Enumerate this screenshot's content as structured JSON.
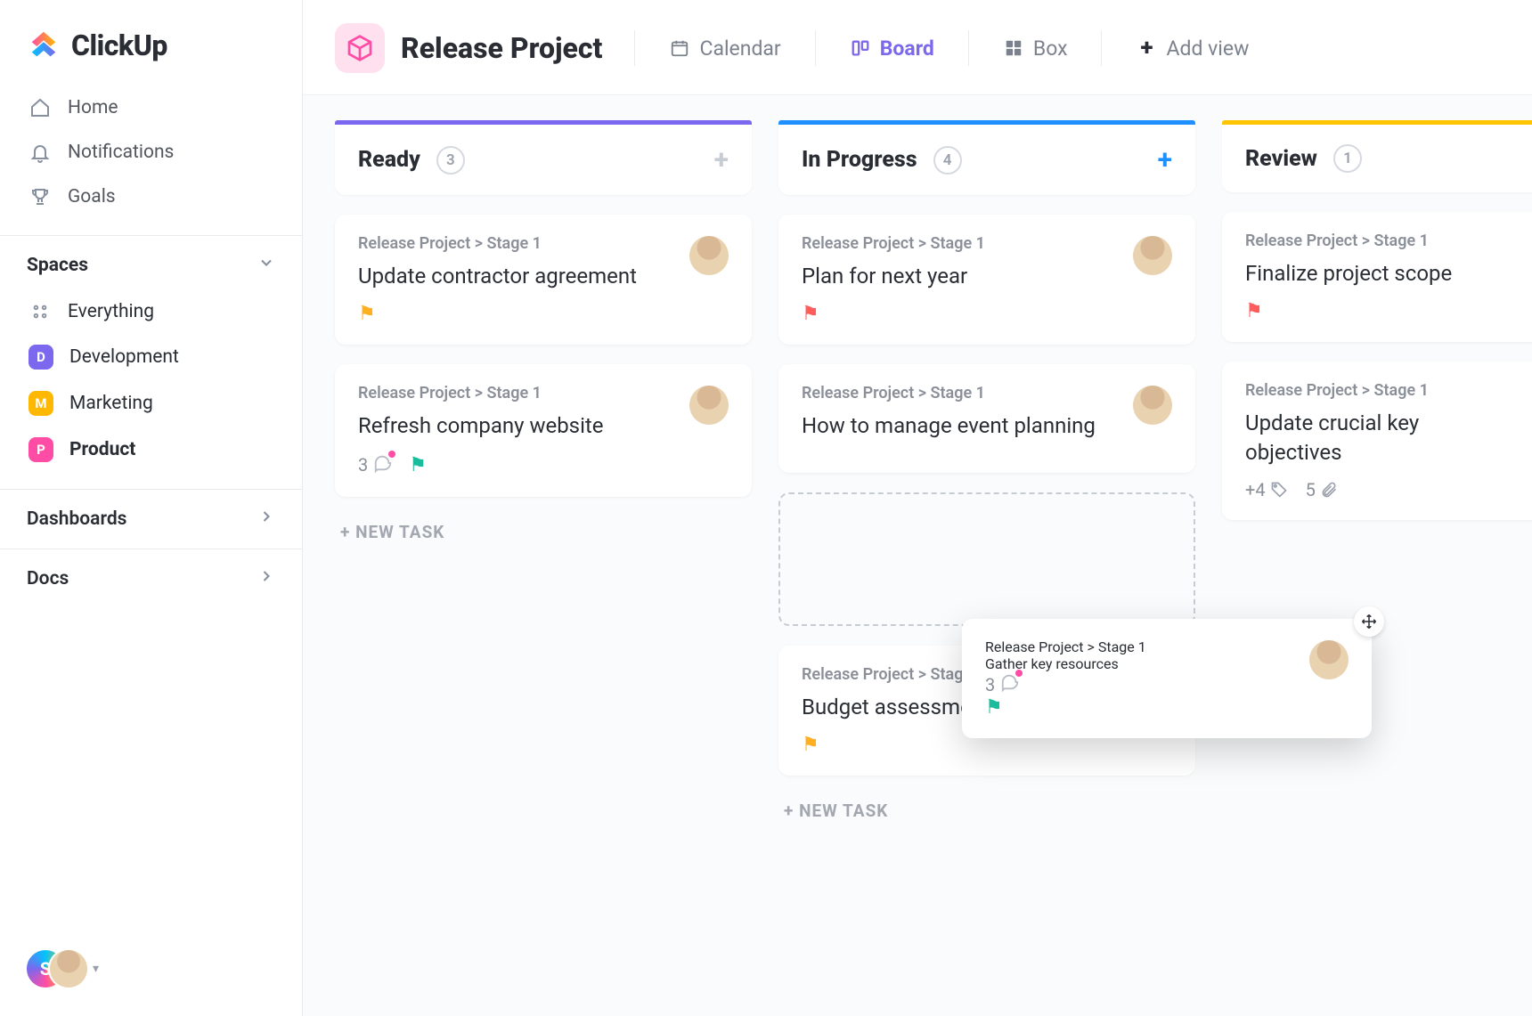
{
  "brand": "ClickUp",
  "nav": {
    "home": "Home",
    "notifications": "Notifications",
    "goals": "Goals"
  },
  "spaces": {
    "header": "Spaces",
    "everything": "Everything",
    "items": [
      {
        "letter": "D",
        "label": "Development",
        "color": "#7b68ee"
      },
      {
        "letter": "M",
        "label": "Marketing",
        "color": "#ffb800"
      },
      {
        "letter": "P",
        "label": "Product",
        "color": "#ff4da6"
      }
    ]
  },
  "side": {
    "dashboards": "Dashboards",
    "docs": "Docs"
  },
  "user": {
    "initial": "S"
  },
  "project": {
    "title": "Release Project"
  },
  "views": {
    "calendar": "Calendar",
    "board": "Board",
    "box": "Box",
    "add": "Add view"
  },
  "board": {
    "new_task": "+ NEW TASK",
    "columns": [
      {
        "title": "Ready",
        "count": "3",
        "bar": "#7b68ee",
        "add_color": "#c7ccd4",
        "cards": [
          {
            "crumb": "Release Project > Stage 1",
            "title": "Update contractor agreement",
            "flag_color": "#ffb020",
            "avatar_bg": "#f6e7b0",
            "comments": "",
            "show_avatar": true
          },
          {
            "crumb": "Release Project > Stage 1",
            "title": "Refresh company website",
            "flag_color": "#1abc9c",
            "avatar_bg": "#f3d9c9",
            "comments": "3",
            "show_avatar": true
          }
        ],
        "show_new_task": true
      },
      {
        "title": "In Progress",
        "count": "4",
        "bar": "#1e90ff",
        "add_color": "#1e90ff",
        "cards": [
          {
            "crumb": "Release Project > Stage 1",
            "title": "Plan for next year",
            "flag_color": "#ff5c5c",
            "avatar_bg": "#e9d2af",
            "comments": "",
            "show_avatar": true
          },
          {
            "crumb": "Release Project > Stage 1",
            "title": "How to manage event planning",
            "flag_color": "",
            "avatar_bg": "#e9d2af",
            "comments": "",
            "show_avatar": true
          }
        ],
        "dropzone": true,
        "cards_after": [
          {
            "crumb": "Release Project > Stage 1",
            "title": "Budget assessment",
            "flag_color": "#ffb020",
            "avatar_bg": "",
            "comments": "",
            "show_avatar": false
          }
        ],
        "show_new_task": true
      },
      {
        "title": "Review",
        "count": "1",
        "bar": "#ffc400",
        "add_color": "#c7ccd4",
        "cards": [
          {
            "crumb": "Release Project > Stage 1",
            "title": "Finalize project scope",
            "flag_color": "#ff5c5c",
            "avatar_bg": "",
            "comments": "",
            "show_avatar": false
          },
          {
            "crumb": "Release Project > Stage 1",
            "title": "Update crucial key objectives",
            "flag_color": "",
            "avatar_bg": "",
            "comments": "",
            "show_avatar": false,
            "tags": "+4",
            "attach": "5"
          }
        ],
        "show_new_task": false
      }
    ],
    "dragging_card": {
      "crumb": "Release Project > Stage 1",
      "title": "Gather key resources",
      "comments": "3",
      "flag_color": "#1abc9c",
      "avatar_bg": "#f3d9c9"
    }
  }
}
